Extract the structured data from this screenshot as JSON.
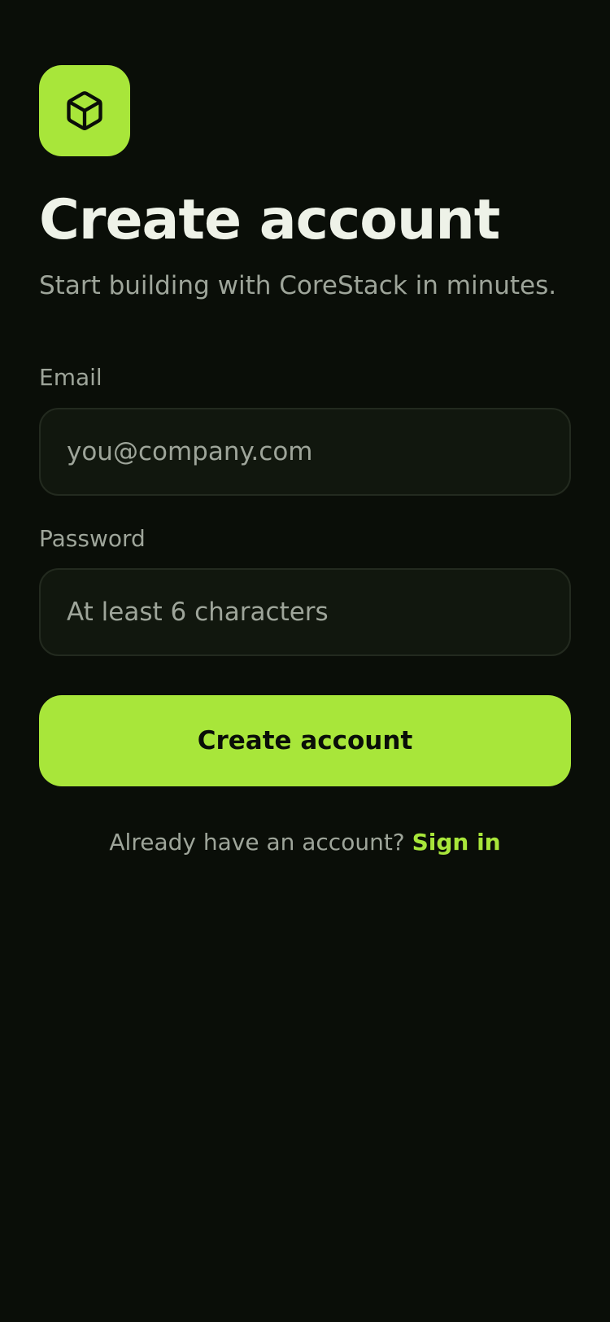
{
  "brand": {
    "logo_icon": "cube-icon",
    "logo_bg_color": "#a8e63a"
  },
  "header": {
    "title": "Create account",
    "subtitle": "Start building with CoreStack in minutes."
  },
  "form": {
    "email": {
      "label": "Email",
      "value": "",
      "placeholder": "you@company.com"
    },
    "password": {
      "label": "Password",
      "value": "",
      "placeholder": "At least 6 characters"
    },
    "submit_label": "Create account"
  },
  "footer": {
    "prompt": "Already have an account?",
    "link_label": "Sign in"
  },
  "colors": {
    "background": "#0a0e08",
    "accent": "#a8e63a",
    "text_primary": "#eef2e8",
    "text_muted": "#9ea59a",
    "input_bg": "#11170e"
  }
}
